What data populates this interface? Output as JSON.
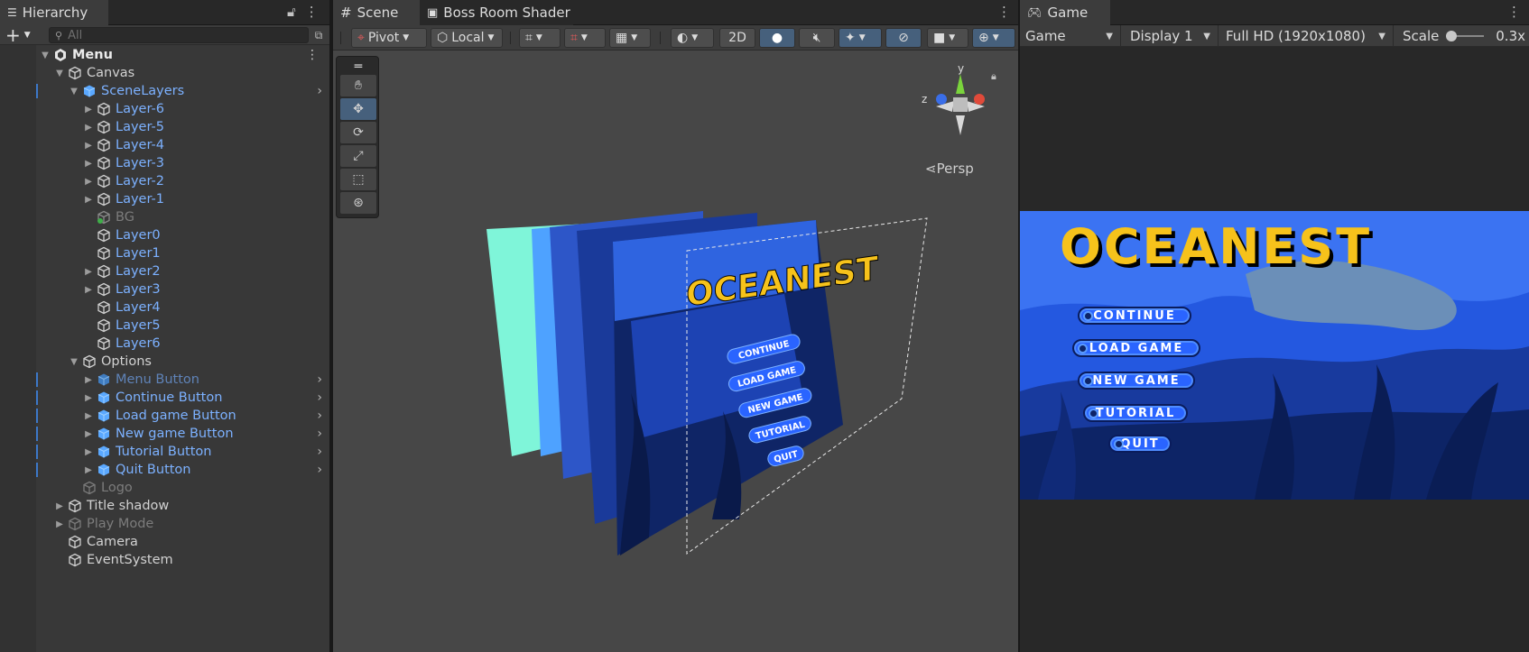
{
  "hierarchy": {
    "tab_label": "Hierarchy",
    "search_placeholder": "All",
    "items": [
      {
        "label": "Menu"
      },
      {
        "label": "Canvas"
      },
      {
        "label": "SceneLayers"
      },
      {
        "label": "Layer-6"
      },
      {
        "label": "Layer-5"
      },
      {
        "label": "Layer-4"
      },
      {
        "label": "Layer-3"
      },
      {
        "label": "Layer-2"
      },
      {
        "label": "Layer-1"
      },
      {
        "label": "BG"
      },
      {
        "label": "Layer0"
      },
      {
        "label": "Layer1"
      },
      {
        "label": "Layer2"
      },
      {
        "label": "Layer3"
      },
      {
        "label": "Layer4"
      },
      {
        "label": "Layer5"
      },
      {
        "label": "Layer6"
      },
      {
        "label": "Options"
      },
      {
        "label": "Menu Button"
      },
      {
        "label": "Continue Button"
      },
      {
        "label": "Load game Button"
      },
      {
        "label": "New game Button"
      },
      {
        "label": "Tutorial Button"
      },
      {
        "label": "Quit Button"
      },
      {
        "label": "Logo"
      },
      {
        "label": "Title shadow"
      },
      {
        "label": "Play Mode"
      },
      {
        "label": "Camera"
      },
      {
        "label": "EventSystem"
      }
    ]
  },
  "scene": {
    "tab_label": "Scene",
    "tab2_label": "Boss Room Shader",
    "pivot_label": "Pivot",
    "local_label": "Local",
    "mode_2d_label": "2D",
    "persp_label": "Persp",
    "gizmo_axes": {
      "x": "x",
      "y": "y",
      "z": "z"
    }
  },
  "game": {
    "tab_label": "Game",
    "view_dropdown": "Game",
    "display_dropdown": "Display 1",
    "resolution_dropdown": "Full HD (1920x1080)",
    "scale_label": "Scale",
    "scale_value": "0.3x"
  },
  "game_ui": {
    "logo": "OCEANEST",
    "buttons": [
      "CONTINUE",
      "LOAD GAME",
      "NEW GAME",
      "TUTORIAL",
      "QUIT"
    ]
  },
  "colors": {
    "accent": "#3c78c8",
    "hierarchy_blue_text": "#7cb1ff",
    "logo_yellow": "#f6c21b",
    "ocean_blue": "#2a64ff"
  }
}
